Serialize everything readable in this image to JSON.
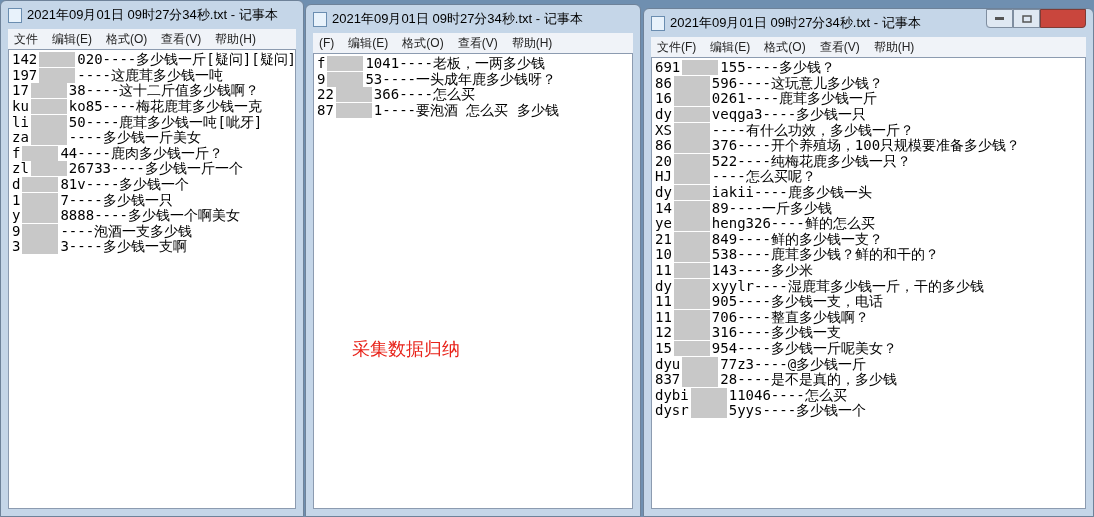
{
  "windows": [
    {
      "title": "2021年09月01日 09时27分34秒.txt - 记事本",
      "caption_buttons": false,
      "menu": [
        "文件",
        "编辑(E)",
        "格式(O)",
        "查看(V)",
        "帮助(H)"
      ],
      "lines": [
        {
          "start": "142",
          "end": "020----多少钱一斤[疑问][疑问]"
        },
        {
          "start": "197",
          "end": "----这鹿茸多少钱一吨"
        },
        {
          "start": "17",
          "end": "38----这十二斤值多少钱啊？"
        },
        {
          "start": "ku",
          "end": "ko85----梅花鹿茸多少钱一克"
        },
        {
          "start": "li",
          "end": "50----鹿茸多少钱一吨[呲牙]"
        },
        {
          "start": "za",
          "end": "----多少钱一斤美女"
        },
        {
          "start": "f",
          "end": "44----鹿肉多少钱一斤？"
        },
        {
          "start": "zl",
          "end": "26733----多少钱一斤一个"
        },
        {
          "start": "d",
          "end": "81v----多少钱一个"
        },
        {
          "start": "1",
          "end": "7----多少钱一只"
        },
        {
          "start": "y",
          "end": "8888----多少钱一个啊美女"
        },
        {
          "start": "9",
          "end": "----泡酒一支多少钱"
        },
        {
          "start": "3",
          "end": "3----多少钱一支啊"
        }
      ]
    },
    {
      "title": "2021年09月01日 09时27分34秒.txt - 记事本",
      "caption_buttons": false,
      "menu": [
        "(F)",
        "编辑(E)",
        "格式(O)",
        "查看(V)",
        "帮助(H)"
      ],
      "lines": [
        {
          "start": "f",
          "end": "1041----老板，一两多少钱"
        },
        {
          "start": "9",
          "end": "53----一头成年鹿多少钱呀？"
        },
        {
          "start": "22",
          "end": "366----怎么买"
        },
        {
          "start": "87",
          "end": "1----要泡酒 怎么买 多少钱"
        }
      ],
      "annotation": "采集数据归纳"
    },
    {
      "title": "2021年09月01日 09时27分34秒.txt - 记事本",
      "caption_buttons": true,
      "menu": [
        "文件(F)",
        "编辑(E)",
        "格式(O)",
        "查看(V)",
        "帮助(H)"
      ],
      "lines": [
        {
          "start": "691",
          "end": "155----多少钱？"
        },
        {
          "start": "86",
          "end": "596----这玩意儿多少钱？"
        },
        {
          "start": "16",
          "end": "0261----鹿茸多少钱一斤"
        },
        {
          "start": "dy",
          "end": "veqga3----多少钱一只"
        },
        {
          "start": "XS",
          "end": "----有什么功效，多少钱一斤？"
        },
        {
          "start": "86",
          "end": "376----开个养殖场，100只规模要准备多少钱？"
        },
        {
          "start": "20",
          "end": "522----纯梅花鹿多少钱一只？"
        },
        {
          "start": "HJ",
          "end": "----怎么买呢？"
        },
        {
          "start": "dy",
          "end": "iakii----鹿多少钱一头"
        },
        {
          "start": "14",
          "end": "89----一斤多少钱"
        },
        {
          "start": "ye",
          "end": "heng326----鲜的怎么买"
        },
        {
          "start": "21",
          "end": "849----鲜的多少钱一支？"
        },
        {
          "start": "10",
          "end": "538----鹿茸多少钱？鲜的和干的？"
        },
        {
          "start": "11",
          "end": "143----多少米"
        },
        {
          "start": "dy",
          "end": "xyylr----湿鹿茸多少钱一斤，干的多少钱"
        },
        {
          "start": "11",
          "end": "905----多少钱一支，电话"
        },
        {
          "start": "11",
          "end": "706----整直多少钱啊？"
        },
        {
          "start": "12",
          "end": "316----多少钱一支"
        },
        {
          "start": "15",
          "end": "954----多少钱一斤呢美女？"
        },
        {
          "start": "dyu",
          "end": "77z3----@多少钱一斤"
        },
        {
          "start": "837",
          "end": "28----是不是真的，多少钱"
        },
        {
          "start": "dybi",
          "end": "11046----怎么买"
        },
        {
          "start": "dysr",
          "end": "5yys----多少钱一个"
        }
      ]
    }
  ]
}
